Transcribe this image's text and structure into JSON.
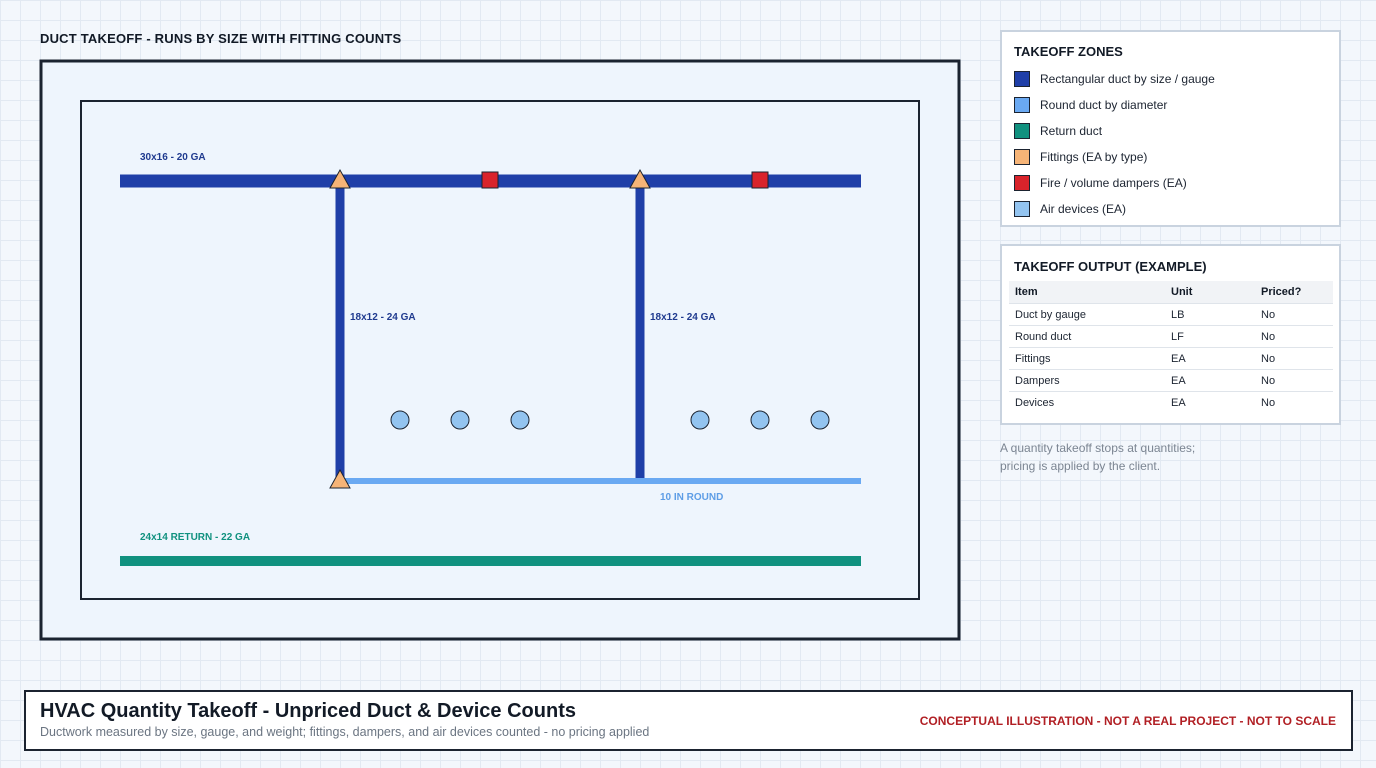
{
  "drawing": {
    "title": "DUCT TAKEOFF - RUNS BY SIZE WITH FITTING COUNTS",
    "labels": {
      "supply_main": "30x16 - 20 GA",
      "branch_left": "18x12 - 24 GA",
      "branch_right": "18x12 - 24 GA",
      "round": "10 IN ROUND",
      "return": "24x14 RETURN - 22 GA"
    }
  },
  "legend": {
    "title": "TAKEOFF ZONES",
    "items": [
      {
        "label": "Rectangular duct by size / gauge",
        "color": "#1f3fa8"
      },
      {
        "label": "Round duct by diameter",
        "color": "#6aa9f2"
      },
      {
        "label": "Return duct",
        "color": "#10917f"
      },
      {
        "label": "Fittings (EA by type)",
        "color": "#f6b477"
      },
      {
        "label": "Fire / volume dampers (EA)",
        "color": "#d9232b"
      },
      {
        "label": "Air devices (EA)",
        "color": "#93c4f0"
      }
    ]
  },
  "output": {
    "title": "TAKEOFF OUTPUT (EXAMPLE)",
    "headers": [
      "Item",
      "Unit",
      "Priced?"
    ],
    "rows": [
      [
        "Duct by gauge",
        "LB",
        "No"
      ],
      [
        "Round duct",
        "LF",
        "No"
      ],
      [
        "Fittings",
        "EA",
        "No"
      ],
      [
        "Dampers",
        "EA",
        "No"
      ],
      [
        "Devices",
        "EA",
        "No"
      ]
    ]
  },
  "note": {
    "line1": "A quantity takeoff stops at quantities;",
    "line2": "pricing is applied by the client."
  },
  "titleblock": {
    "title": "HVAC Quantity Takeoff - Unpriced Duct & Device Counts",
    "subtitle": "Ductwork measured by size, gauge, and weight; fittings, dampers, and air devices counted - no pricing applied",
    "disclaimer": "CONCEPTUAL ILLUSTRATION - NOT A REAL PROJECT - NOT TO SCALE"
  }
}
